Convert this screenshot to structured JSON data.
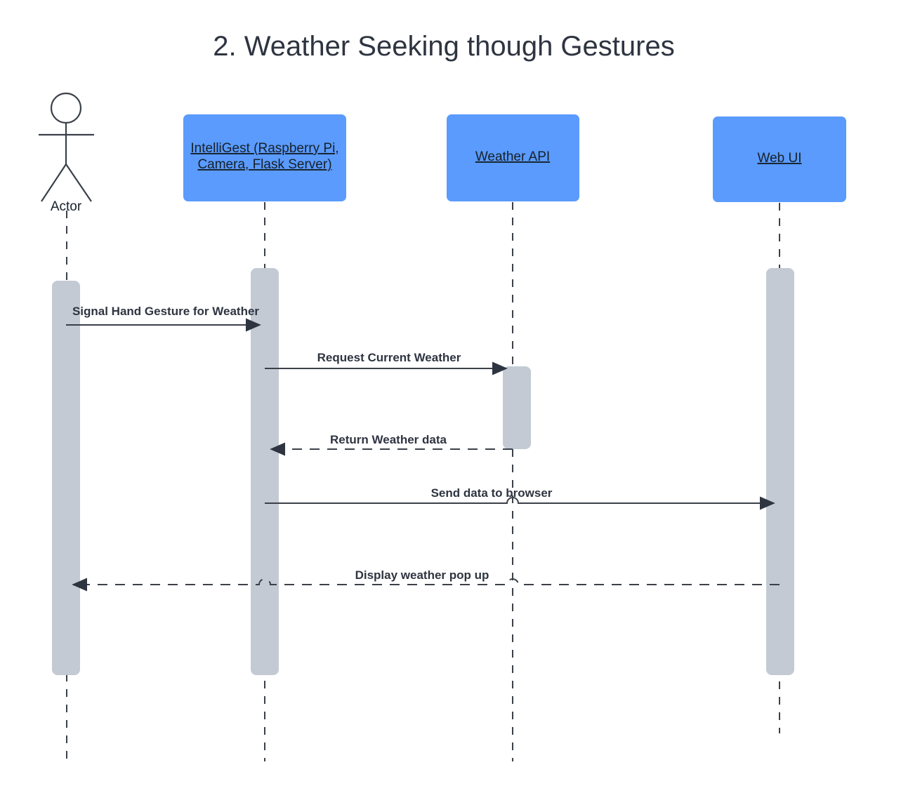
{
  "diagram": {
    "title": "2. Weather Seeking though Gestures",
    "type": "uml-sequence-diagram",
    "colors": {
      "participant_fill": "#5a9bfd",
      "activation_fill": "#c3cad4",
      "line": "#3b4048",
      "text": "#2e3440",
      "background": "#ffffff"
    },
    "actor": {
      "name": "Actor",
      "label": "Actor"
    },
    "participants": [
      {
        "id": "intelligest",
        "label_line1": "IntelliGest  (Raspberry Pi,",
        "label_line2": "Camera, Flask Server)"
      },
      {
        "id": "weather_api",
        "label_line1": "Weather API",
        "label_line2": ""
      },
      {
        "id": "web_ui",
        "label_line1": "Web UI",
        "label_line2": ""
      }
    ],
    "messages": [
      {
        "index": 1,
        "label": "Signal Hand Gesture for Weather",
        "from": "Actor",
        "to": "IntelliGest  (Raspberry Pi, Camera, Flask Server)",
        "style": "solid",
        "direction": "right"
      },
      {
        "index": 2,
        "label": "Request Current Weather",
        "from": "IntelliGest  (Raspberry Pi, Camera, Flask Server)",
        "to": "Weather API",
        "style": "solid",
        "direction": "right"
      },
      {
        "index": 3,
        "label": "Return Weather data",
        "from": "Weather API",
        "to": "IntelliGest  (Raspberry Pi, Camera, Flask Server)",
        "style": "dashed",
        "direction": "left"
      },
      {
        "index": 4,
        "label": "Send data to browser",
        "from": "IntelliGest  (Raspberry Pi, Camera, Flask Server)",
        "to": "Web UI",
        "style": "solid",
        "direction": "right"
      },
      {
        "index": 5,
        "label": "Display weather pop up",
        "from": "Web UI",
        "to": "Actor",
        "style": "dashed",
        "direction": "left"
      }
    ]
  }
}
